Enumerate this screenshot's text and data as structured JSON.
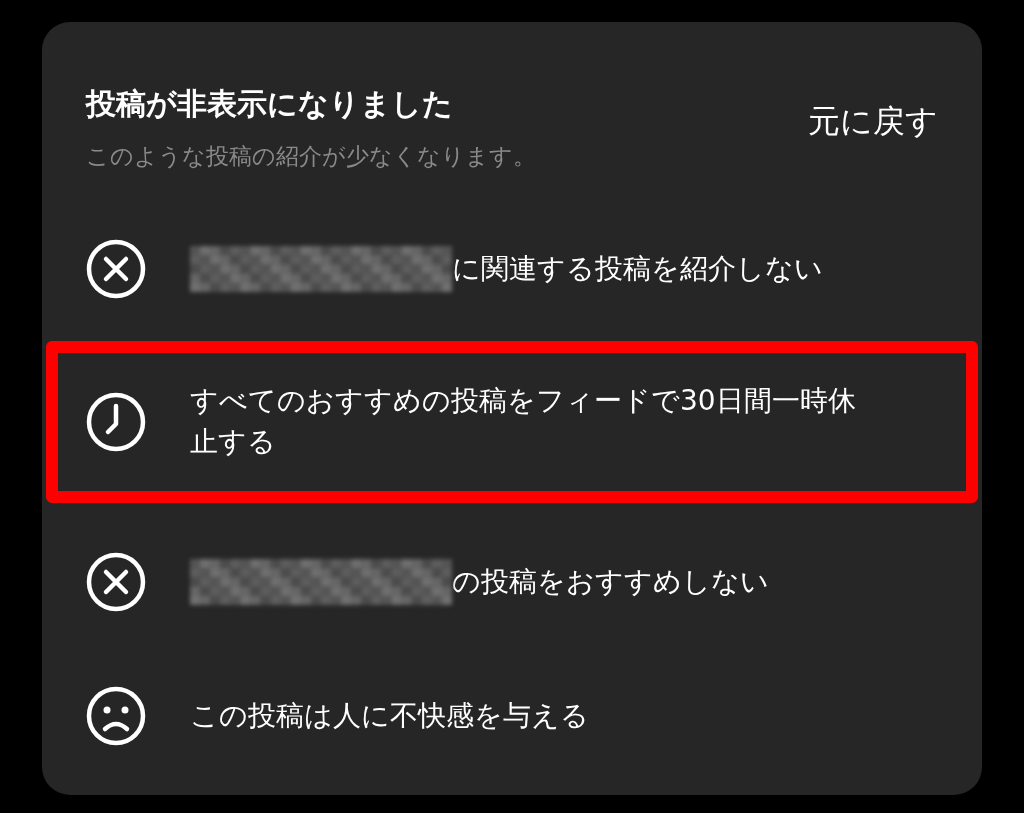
{
  "header": {
    "title": "投稿が非表示になりました",
    "subtitle": "このような投稿の紹介が少なくなります。",
    "undo": "元に戻す"
  },
  "options": [
    {
      "kind": "x",
      "redacted": true,
      "text": "に関連する投稿を紹介しない",
      "highlighted": false
    },
    {
      "kind": "clock",
      "redacted": false,
      "text": "すべてのおすすめの投稿をフィードで30日間一時休止する",
      "highlighted": true
    },
    {
      "kind": "x",
      "redacted": true,
      "text": "の投稿をおすすめしない",
      "highlighted": false
    },
    {
      "kind": "sad",
      "redacted": false,
      "text": "この投稿は人に不快感を与える",
      "highlighted": false
    }
  ]
}
